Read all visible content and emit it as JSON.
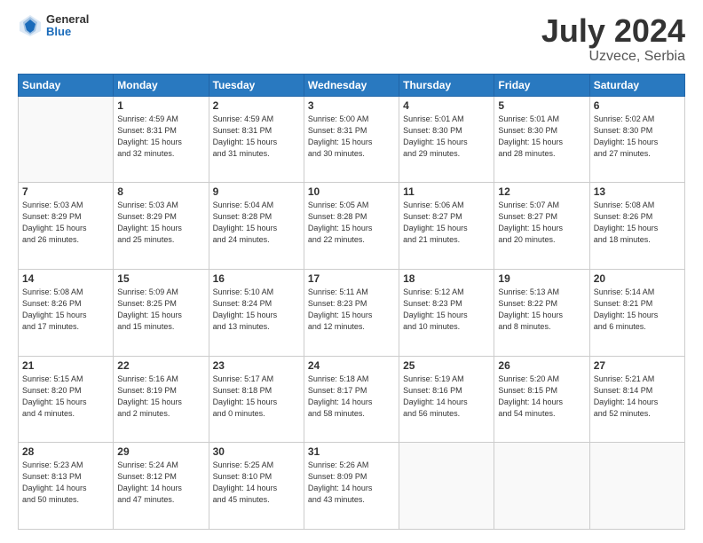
{
  "header": {
    "logo_general": "General",
    "logo_blue": "Blue",
    "month_year": "July 2024",
    "location": "Uzvece, Serbia"
  },
  "weekdays": [
    "Sunday",
    "Monday",
    "Tuesday",
    "Wednesday",
    "Thursday",
    "Friday",
    "Saturday"
  ],
  "weeks": [
    [
      {
        "day": "",
        "text": ""
      },
      {
        "day": "1",
        "text": "Sunrise: 4:59 AM\nSunset: 8:31 PM\nDaylight: 15 hours\nand 32 minutes."
      },
      {
        "day": "2",
        "text": "Sunrise: 4:59 AM\nSunset: 8:31 PM\nDaylight: 15 hours\nand 31 minutes."
      },
      {
        "day": "3",
        "text": "Sunrise: 5:00 AM\nSunset: 8:31 PM\nDaylight: 15 hours\nand 30 minutes."
      },
      {
        "day": "4",
        "text": "Sunrise: 5:01 AM\nSunset: 8:30 PM\nDaylight: 15 hours\nand 29 minutes."
      },
      {
        "day": "5",
        "text": "Sunrise: 5:01 AM\nSunset: 8:30 PM\nDaylight: 15 hours\nand 28 minutes."
      },
      {
        "day": "6",
        "text": "Sunrise: 5:02 AM\nSunset: 8:30 PM\nDaylight: 15 hours\nand 27 minutes."
      }
    ],
    [
      {
        "day": "7",
        "text": "Sunrise: 5:03 AM\nSunset: 8:29 PM\nDaylight: 15 hours\nand 26 minutes."
      },
      {
        "day": "8",
        "text": "Sunrise: 5:03 AM\nSunset: 8:29 PM\nDaylight: 15 hours\nand 25 minutes."
      },
      {
        "day": "9",
        "text": "Sunrise: 5:04 AM\nSunset: 8:28 PM\nDaylight: 15 hours\nand 24 minutes."
      },
      {
        "day": "10",
        "text": "Sunrise: 5:05 AM\nSunset: 8:28 PM\nDaylight: 15 hours\nand 22 minutes."
      },
      {
        "day": "11",
        "text": "Sunrise: 5:06 AM\nSunset: 8:27 PM\nDaylight: 15 hours\nand 21 minutes."
      },
      {
        "day": "12",
        "text": "Sunrise: 5:07 AM\nSunset: 8:27 PM\nDaylight: 15 hours\nand 20 minutes."
      },
      {
        "day": "13",
        "text": "Sunrise: 5:08 AM\nSunset: 8:26 PM\nDaylight: 15 hours\nand 18 minutes."
      }
    ],
    [
      {
        "day": "14",
        "text": "Sunrise: 5:08 AM\nSunset: 8:26 PM\nDaylight: 15 hours\nand 17 minutes."
      },
      {
        "day": "15",
        "text": "Sunrise: 5:09 AM\nSunset: 8:25 PM\nDaylight: 15 hours\nand 15 minutes."
      },
      {
        "day": "16",
        "text": "Sunrise: 5:10 AM\nSunset: 8:24 PM\nDaylight: 15 hours\nand 13 minutes."
      },
      {
        "day": "17",
        "text": "Sunrise: 5:11 AM\nSunset: 8:23 PM\nDaylight: 15 hours\nand 12 minutes."
      },
      {
        "day": "18",
        "text": "Sunrise: 5:12 AM\nSunset: 8:23 PM\nDaylight: 15 hours\nand 10 minutes."
      },
      {
        "day": "19",
        "text": "Sunrise: 5:13 AM\nSunset: 8:22 PM\nDaylight: 15 hours\nand 8 minutes."
      },
      {
        "day": "20",
        "text": "Sunrise: 5:14 AM\nSunset: 8:21 PM\nDaylight: 15 hours\nand 6 minutes."
      }
    ],
    [
      {
        "day": "21",
        "text": "Sunrise: 5:15 AM\nSunset: 8:20 PM\nDaylight: 15 hours\nand 4 minutes."
      },
      {
        "day": "22",
        "text": "Sunrise: 5:16 AM\nSunset: 8:19 PM\nDaylight: 15 hours\nand 2 minutes."
      },
      {
        "day": "23",
        "text": "Sunrise: 5:17 AM\nSunset: 8:18 PM\nDaylight: 15 hours\nand 0 minutes."
      },
      {
        "day": "24",
        "text": "Sunrise: 5:18 AM\nSunset: 8:17 PM\nDaylight: 14 hours\nand 58 minutes."
      },
      {
        "day": "25",
        "text": "Sunrise: 5:19 AM\nSunset: 8:16 PM\nDaylight: 14 hours\nand 56 minutes."
      },
      {
        "day": "26",
        "text": "Sunrise: 5:20 AM\nSunset: 8:15 PM\nDaylight: 14 hours\nand 54 minutes."
      },
      {
        "day": "27",
        "text": "Sunrise: 5:21 AM\nSunset: 8:14 PM\nDaylight: 14 hours\nand 52 minutes."
      }
    ],
    [
      {
        "day": "28",
        "text": "Sunrise: 5:23 AM\nSunset: 8:13 PM\nDaylight: 14 hours\nand 50 minutes."
      },
      {
        "day": "29",
        "text": "Sunrise: 5:24 AM\nSunset: 8:12 PM\nDaylight: 14 hours\nand 47 minutes."
      },
      {
        "day": "30",
        "text": "Sunrise: 5:25 AM\nSunset: 8:10 PM\nDaylight: 14 hours\nand 45 minutes."
      },
      {
        "day": "31",
        "text": "Sunrise: 5:26 AM\nSunset: 8:09 PM\nDaylight: 14 hours\nand 43 minutes."
      },
      {
        "day": "",
        "text": ""
      },
      {
        "day": "",
        "text": ""
      },
      {
        "day": "",
        "text": ""
      }
    ]
  ]
}
